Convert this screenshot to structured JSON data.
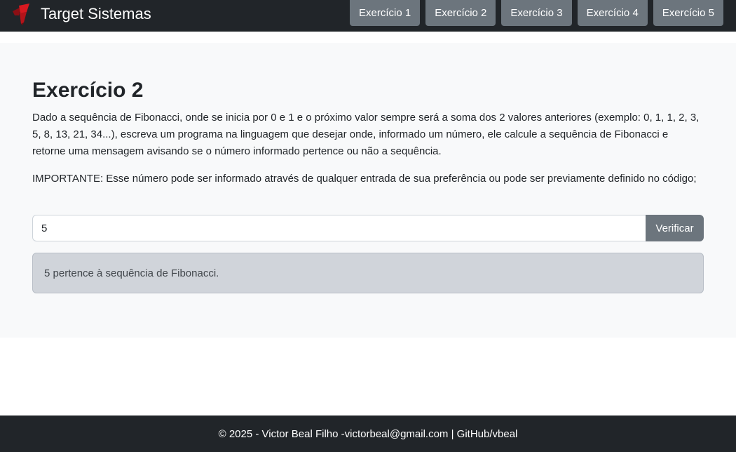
{
  "navbar": {
    "brand_name": "Target Sistemas",
    "logo_icon": "red-target-logo-icon",
    "items": [
      {
        "label": "Exercício 1"
      },
      {
        "label": "Exercício 2"
      },
      {
        "label": "Exercício 3"
      },
      {
        "label": "Exercício 4"
      },
      {
        "label": "Exercício 5"
      }
    ]
  },
  "main": {
    "title": "Exercício 2",
    "description": "Dado a sequência de Fibonacci, onde se inicia por 0 e 1 e o próximo valor sempre será a soma dos 2 valores anteriores (exemplo: 0, 1, 1, 2, 3, 5, 8, 13, 21, 34...), escreva um programa na linguagem que desejar onde, informado um número, ele calcule a sequência de Fibonacci e retorne uma mensagem avisando se o número informado pertence ou não a sequência.",
    "note": "IMPORTANTE: Esse número pode ser informado através de qualquer entrada de sua preferência ou pode ser previamente definido no código;",
    "input_value": "5",
    "verify_label": "Verificar",
    "result": "5 pertence à sequência de Fibonacci."
  },
  "footer": {
    "copyright": "© 2025 - Victor Beal Filho - ",
    "email": "victorbeal@gmail.com",
    "separator": " | ",
    "github": "GitHub/vbeal"
  },
  "colors": {
    "navbar": "#212529",
    "button": "#6c757d",
    "main_bg": "#f8f9fa",
    "result_bg": "#d0d4da",
    "logo": "#d71920"
  }
}
